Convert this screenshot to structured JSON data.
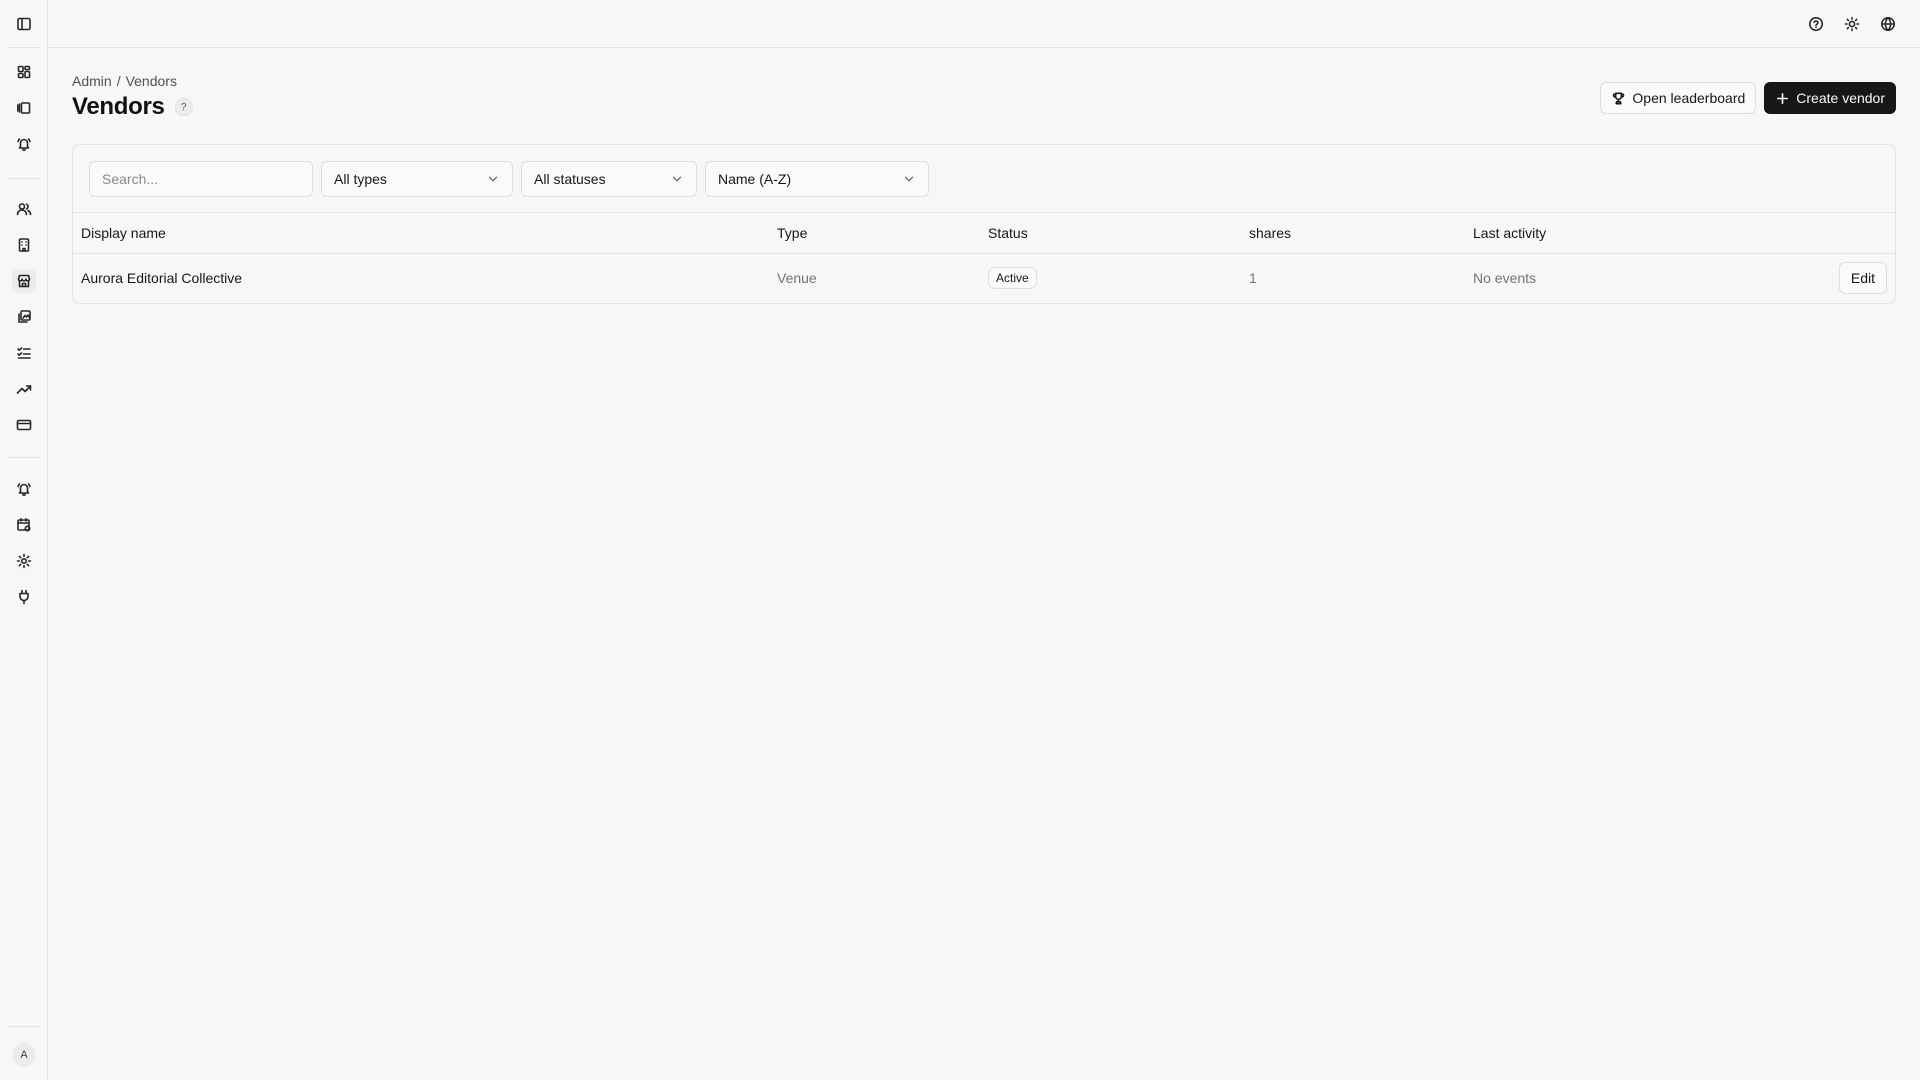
{
  "sidebar": {
    "icons": [
      "panel-toggle-icon",
      "dashboard-icon",
      "library-icon",
      "alerts-icon",
      "users-icon",
      "building-icon",
      "store-icon",
      "media-icon",
      "tasks-icon",
      "trending-icon",
      "billing-icon",
      "notifications-icon",
      "calendar-settings-icon",
      "settings-icon",
      "integrations-icon"
    ],
    "avatar": "A"
  },
  "topbar": {
    "icons": [
      "help-icon",
      "theme-icon",
      "language-icon"
    ]
  },
  "breadcrumb": {
    "root": "Admin",
    "separator": "/",
    "current": "Vendors"
  },
  "page": {
    "title": "Vendors",
    "help": "?"
  },
  "actions": {
    "leaderboard_label": "Open leaderboard",
    "create_label": "Create vendor"
  },
  "filters": {
    "search_placeholder": "Search...",
    "type_value": "All types",
    "status_value": "All statuses",
    "sort_value": "Name (A-Z)"
  },
  "table": {
    "columns": [
      "Display name",
      "Type",
      "Status",
      "shares",
      "Last activity"
    ],
    "rows": [
      {
        "name": "Aurora Editorial Collective",
        "type": "Venue",
        "status": "Active",
        "shares": "1",
        "last_activity": "No events",
        "action": "Edit"
      }
    ]
  }
}
